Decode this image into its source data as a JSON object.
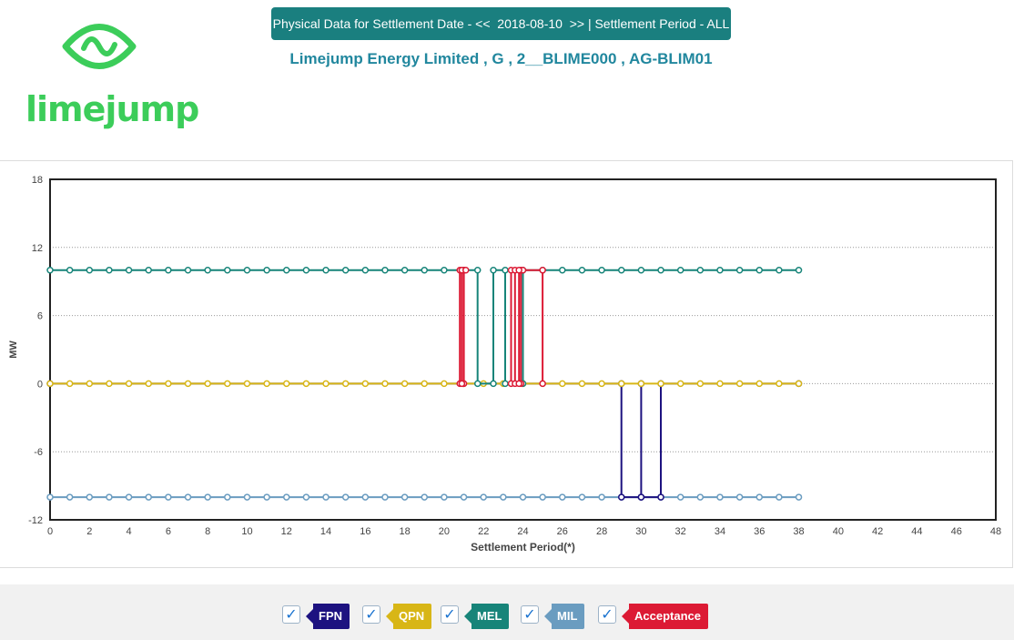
{
  "logo": {
    "text": "limejump",
    "icon": "limejump-wave-eye-icon",
    "color": "#3ccd5a"
  },
  "header": {
    "title": "Physical Data for Settlement Date - <<  2018-08-10  >> | Settlement Period - ALL",
    "subtitle": "Limejump Energy Limited , G , 2__BLIME000 , AG-BLIM01"
  },
  "chart_data": {
    "type": "line",
    "xlabel": "Settlement Period(*)",
    "ylabel": "MW",
    "xlim": [
      0,
      48
    ],
    "ylim": [
      -12,
      18
    ],
    "xticks": [
      0,
      2,
      4,
      6,
      8,
      10,
      12,
      14,
      16,
      18,
      20,
      22,
      24,
      26,
      28,
      30,
      32,
      34,
      36,
      38,
      40,
      42,
      44,
      46,
      48
    ],
    "yticks": [
      -12,
      -6,
      0,
      6,
      12,
      18
    ],
    "grid": "horizontal dotted",
    "legend_position": "bottom",
    "series": [
      {
        "name": "MIL",
        "color": "#6a9cc0",
        "points": [
          [
            0,
            -10
          ],
          [
            1,
            -10
          ],
          [
            2,
            -10
          ],
          [
            3,
            -10
          ],
          [
            4,
            -10
          ],
          [
            5,
            -10
          ],
          [
            6,
            -10
          ],
          [
            7,
            -10
          ],
          [
            8,
            -10
          ],
          [
            9,
            -10
          ],
          [
            10,
            -10
          ],
          [
            11,
            -10
          ],
          [
            12,
            -10
          ],
          [
            13,
            -10
          ],
          [
            14,
            -10
          ],
          [
            15,
            -10
          ],
          [
            16,
            -10
          ],
          [
            17,
            -10
          ],
          [
            18,
            -10
          ],
          [
            19,
            -10
          ],
          [
            20,
            -10
          ],
          [
            21,
            -10
          ],
          [
            22,
            -10
          ],
          [
            23,
            -10
          ],
          [
            24,
            -10
          ],
          [
            25,
            -10
          ],
          [
            26,
            -10
          ],
          [
            27,
            -10
          ],
          [
            28,
            -10
          ],
          [
            29,
            -10
          ],
          [
            30,
            -10
          ],
          [
            31,
            -10
          ],
          [
            32,
            -10
          ],
          [
            33,
            -10
          ],
          [
            34,
            -10
          ],
          [
            35,
            -10
          ],
          [
            36,
            -10
          ],
          [
            37,
            -10
          ],
          [
            38,
            -10
          ]
        ]
      },
      {
        "name": "FPN",
        "color": "#1d1280",
        "points": [
          [
            0,
            0
          ],
          [
            29,
            0
          ],
          [
            29,
            -10
          ],
          [
            30,
            -10
          ],
          [
            30,
            0
          ],
          [
            30,
            -10
          ],
          [
            31,
            -10
          ],
          [
            31,
            0
          ],
          [
            38,
            0
          ]
        ]
      },
      {
        "name": "QPN",
        "color": "#d8b616",
        "points": [
          [
            0,
            0
          ],
          [
            1,
            0
          ],
          [
            2,
            0
          ],
          [
            3,
            0
          ],
          [
            4,
            0
          ],
          [
            5,
            0
          ],
          [
            6,
            0
          ],
          [
            7,
            0
          ],
          [
            8,
            0
          ],
          [
            9,
            0
          ],
          [
            10,
            0
          ],
          [
            11,
            0
          ],
          [
            12,
            0
          ],
          [
            13,
            0
          ],
          [
            14,
            0
          ],
          [
            15,
            0
          ],
          [
            16,
            0
          ],
          [
            17,
            0
          ],
          [
            18,
            0
          ],
          [
            19,
            0
          ],
          [
            20,
            0
          ],
          [
            21,
            0
          ],
          [
            22,
            0
          ],
          [
            23,
            0
          ],
          [
            24,
            0
          ],
          [
            25,
            0
          ],
          [
            26,
            0
          ],
          [
            27,
            0
          ],
          [
            28,
            0
          ],
          [
            29,
            0
          ],
          [
            30,
            0
          ],
          [
            31,
            0
          ],
          [
            32,
            0
          ],
          [
            33,
            0
          ],
          [
            34,
            0
          ],
          [
            35,
            0
          ],
          [
            36,
            0
          ],
          [
            37,
            0
          ],
          [
            38,
            0
          ]
        ]
      },
      {
        "name": "MEL",
        "color": "#178479",
        "points": [
          [
            0,
            10
          ],
          [
            1,
            10
          ],
          [
            2,
            10
          ],
          [
            3,
            10
          ],
          [
            4,
            10
          ],
          [
            5,
            10
          ],
          [
            6,
            10
          ],
          [
            7,
            10
          ],
          [
            8,
            10
          ],
          [
            9,
            10
          ],
          [
            10,
            10
          ],
          [
            11,
            10
          ],
          [
            12,
            10
          ],
          [
            13,
            10
          ],
          [
            14,
            10
          ],
          [
            15,
            10
          ],
          [
            16,
            10
          ],
          [
            17,
            10
          ],
          [
            18,
            10
          ],
          [
            19,
            10
          ],
          [
            20,
            10
          ],
          [
            21,
            10
          ],
          [
            21.7,
            10
          ],
          [
            21.7,
            0
          ],
          [
            22.5,
            0
          ],
          [
            22.5,
            10
          ],
          [
            23.1,
            10
          ],
          [
            23.1,
            0
          ],
          [
            24,
            0
          ],
          [
            24,
            10
          ],
          [
            25,
            10
          ],
          [
            26,
            10
          ],
          [
            27,
            10
          ],
          [
            28,
            10
          ],
          [
            29,
            10
          ],
          [
            30,
            10
          ],
          [
            31,
            10
          ],
          [
            32,
            10
          ],
          [
            33,
            10
          ],
          [
            34,
            10
          ],
          [
            35,
            10
          ],
          [
            36,
            10
          ],
          [
            37,
            10
          ],
          [
            38,
            10
          ]
        ]
      },
      {
        "name": "Acceptance",
        "color": "#dc1a34",
        "points": [
          [
            20.8,
            0
          ],
          [
            20.8,
            10
          ],
          [
            21,
            10
          ],
          [
            21,
            0
          ],
          [
            20.9,
            0
          ],
          [
            20.9,
            10
          ],
          [
            21.1,
            10
          ]
        ],
        "extra_segments": [
          [
            [
              23.4,
              0
            ],
            [
              23.4,
              10
            ],
            [
              23.6,
              10
            ],
            [
              23.6,
              0
            ],
            [
              23.9,
              0
            ],
            [
              23.9,
              10
            ],
            [
              24,
              10
            ]
          ],
          [
            [
              23.8,
              0
            ],
            [
              23.8,
              10
            ],
            [
              25,
              10
            ],
            [
              25,
              0
            ]
          ]
        ]
      }
    ]
  },
  "legend": [
    {
      "label": "FPN",
      "color": "#1d1280",
      "checked": "✓"
    },
    {
      "label": "QPN",
      "color": "#d8b616",
      "checked": "✓"
    },
    {
      "label": "MEL",
      "color": "#178479",
      "checked": "✓"
    },
    {
      "label": "MIL",
      "color": "#6a9cc0",
      "checked": "✓"
    },
    {
      "label": "Acceptance",
      "color": "#dc1a34",
      "checked": "✓"
    }
  ]
}
